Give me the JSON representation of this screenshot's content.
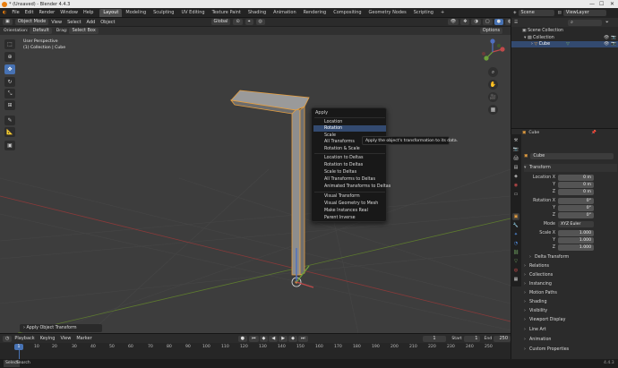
{
  "window": {
    "title": "* (Unsaved) - Blender 4.4.3"
  },
  "topmenu": {
    "items": [
      "File",
      "Edit",
      "Render",
      "Window",
      "Help"
    ],
    "workspaces": [
      "Layout",
      "Modeling",
      "Sculpting",
      "UV Editing",
      "Texture Paint",
      "Shading",
      "Animation",
      "Rendering",
      "Compositing",
      "Geometry Nodes",
      "Scripting"
    ],
    "active_workspace": "Layout",
    "scene_label": "Scene",
    "viewlayer_label": "ViewLayer"
  },
  "viewport_header": {
    "mode": "Object Mode",
    "menus": [
      "View",
      "Select",
      "Add",
      "Object"
    ],
    "orientation_label": "Orientation:",
    "orientation_value": "Default",
    "drag_label": "Drag:",
    "drag_value": "Select Box",
    "transform_space": "Global",
    "options_label": "Options"
  },
  "viewport": {
    "perspective": "User Perspective",
    "collection_info": "(1) Collection | Cube"
  },
  "context_menu": {
    "title": "Apply",
    "items": [
      {
        "label": "Location",
        "highlight": false
      },
      {
        "label": "Rotation",
        "highlight": true
      },
      {
        "label": "Scale",
        "highlight": false
      },
      {
        "label": "All Transforms",
        "highlight": false
      },
      {
        "label": "Rotation & Scale",
        "highlight": false
      },
      {
        "label": "Location to Deltas",
        "highlight": false
      },
      {
        "label": "Rotation to Deltas",
        "highlight": false
      },
      {
        "label": "Scale to Deltas",
        "highlight": false
      },
      {
        "label": "All Transforms to Deltas",
        "highlight": false
      },
      {
        "label": "Animated Transforms to Deltas",
        "highlight": false
      },
      {
        "label": "Visual Transform",
        "highlight": false
      },
      {
        "label": "Visual Geometry to Mesh",
        "highlight": false
      },
      {
        "label": "Make Instances Real",
        "highlight": false
      },
      {
        "label": "Parent Inverse",
        "highlight": false
      }
    ],
    "tooltip": "Apply the object's transformation to its data."
  },
  "last_operator": "Apply Object Transform",
  "timeline": {
    "menus": [
      "Playback",
      "Keying",
      "View",
      "Marker"
    ],
    "current_frame": "1",
    "start_label": "Start",
    "start_value": "1",
    "end_label": "End",
    "end_value": "250",
    "frames": [
      "1",
      "10",
      "20",
      "30",
      "40",
      "50",
      "60",
      "70",
      "80",
      "90",
      "100",
      "110",
      "120",
      "130",
      "140",
      "150",
      "160",
      "170",
      "180",
      "190",
      "200",
      "210",
      "220",
      "230",
      "240",
      "250"
    ]
  },
  "statusbar": {
    "left": "Select",
    "left2": "Search",
    "version": "4.4.3"
  },
  "outliner": {
    "rows": [
      {
        "label": "Scene Collection",
        "indent": 0,
        "icon": "scene-collection-icon",
        "selected": false
      },
      {
        "label": "Collection",
        "indent": 1,
        "icon": "collection-icon",
        "selected": false
      },
      {
        "label": "Cube",
        "indent": 2,
        "icon": "mesh-icon",
        "selected": true
      }
    ]
  },
  "properties": {
    "breadcrumb_object": "Cube",
    "object_name": "Cube",
    "transform_header": "Transform",
    "location_label": "Location X",
    "location": [
      "0 m",
      "0 m",
      "0 m"
    ],
    "rotation_label": "Rotation X",
    "rotation": [
      "0°",
      "0°",
      "0°"
    ],
    "mode_label": "Mode",
    "mode_value": "XYZ Euler",
    "scale_label": "Scale X",
    "scale": [
      "1.000",
      "1.000",
      "1.000"
    ],
    "axis_y": "Y",
    "axis_z": "Z",
    "delta_transform": "Delta Transform",
    "panels": [
      "Relations",
      "Collections",
      "Instancing",
      "Motion Paths",
      "Shading",
      "Visibility",
      "Viewport Display",
      "Line Art",
      "Animation",
      "Custom Properties"
    ]
  },
  "colors": {
    "accent": "#4772b3",
    "selection_orange": "#e8a040",
    "menu_bg": "#181818",
    "highlight": "#334a70"
  }
}
